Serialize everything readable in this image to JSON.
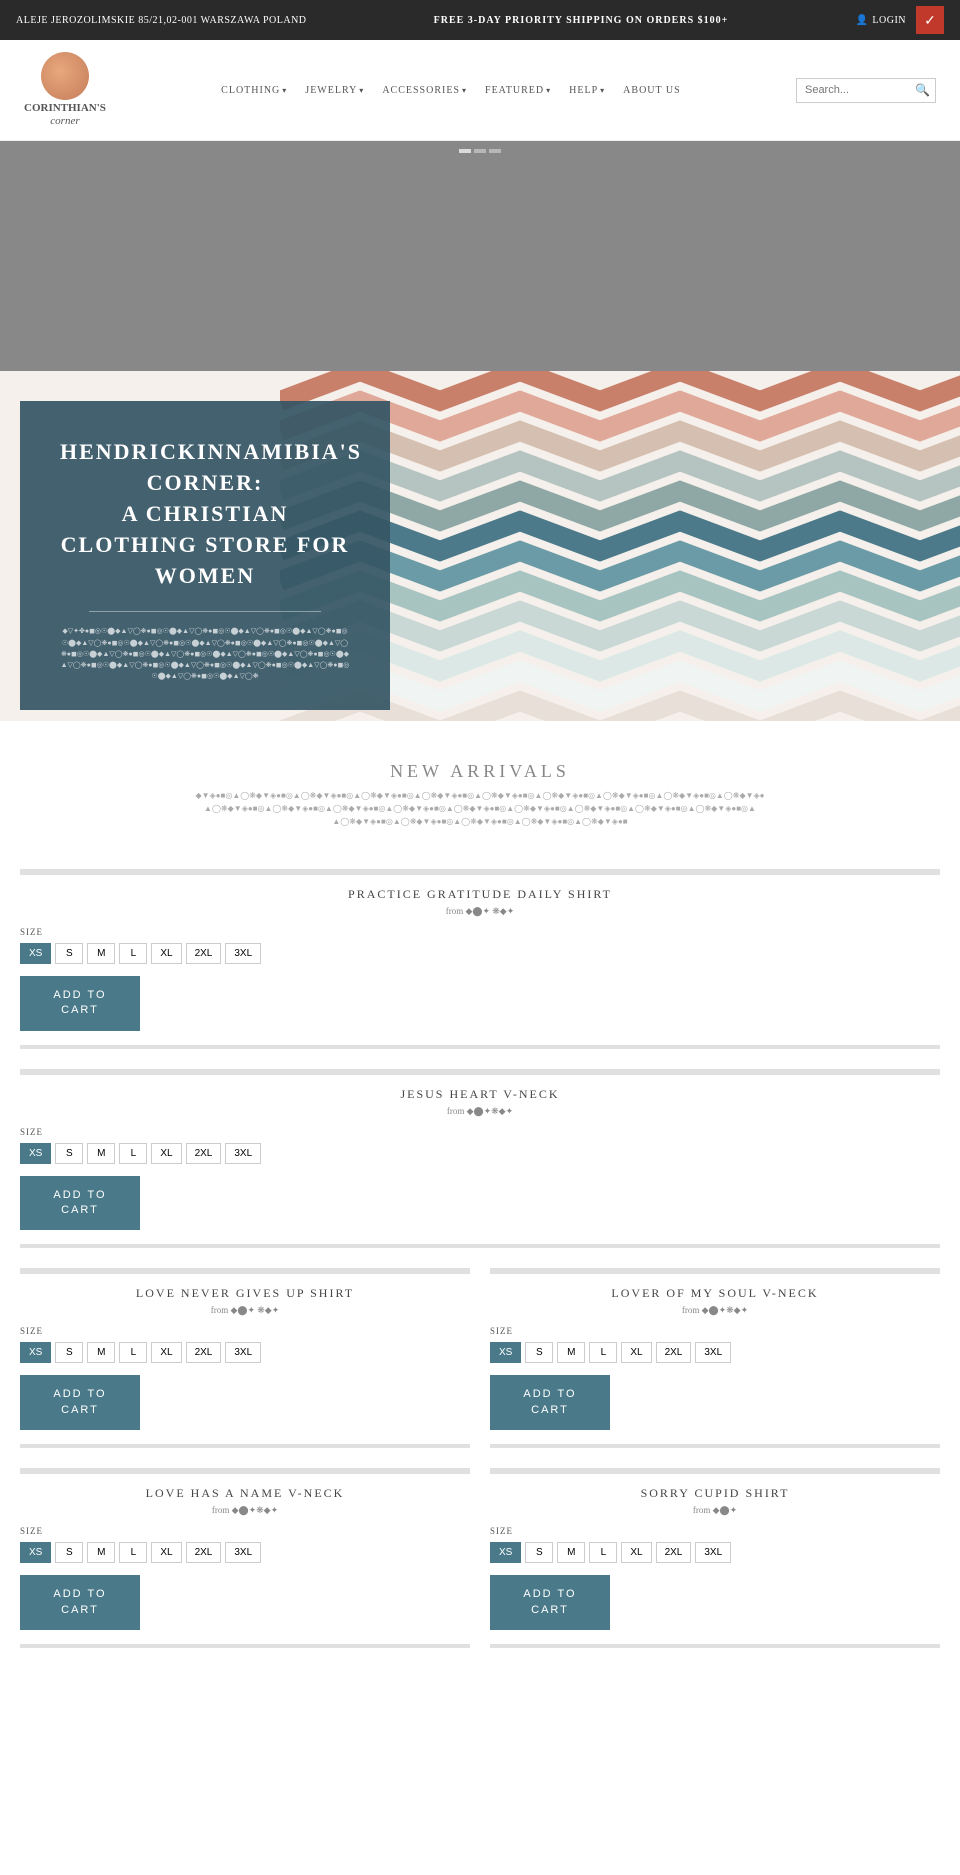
{
  "topbar": {
    "address": "ALEJE JEROZOLIMSKIE 85/21,02-001 WARSZAWA POLAND",
    "shipping": "FREE 3-DAY PRIORITY SHIPPING ON ORDERS $100+",
    "login": "LOGIN",
    "cart_icon": "🛒"
  },
  "header": {
    "logo_name": "CORINTHIAN'S",
    "logo_sub": "corner",
    "nav": [
      {
        "label": "CLOTHING",
        "has_dropdown": true
      },
      {
        "label": "JEWELRY",
        "has_dropdown": true
      },
      {
        "label": "ACCESSORIES",
        "has_dropdown": true
      },
      {
        "label": "FEATURED",
        "has_dropdown": true
      },
      {
        "label": "HELP",
        "has_dropdown": true
      },
      {
        "label": "ABOUT US",
        "has_dropdown": false
      }
    ],
    "search_placeholder": "Search..."
  },
  "hero": {
    "overlay_text": ""
  },
  "promo": {
    "title": "HENDRICKINNAMIBIA'S CORNER:\nA CHRISTIAN CLOTHING STORE FOR WOMEN",
    "symbols": "◆▽✦✤●◼◎☉⬤◆▲▽◯❋●◼◎☉⬤◆▲▽◯❋●◼◎☉⬤◆▲▽◯❋●◼◎☉⬤◆▲▽◯❋●◼◎☉⬤◆▲▽◯❋●◼◎☉⬤◆▲▽◯❋●◼◎☉⬤◆▲▽◯❋●◼◎☉⬤◆▲▽◯❋●◼◎☉⬤◆▲▽◯❋●◼◎☉⬤◆▲▽◯❋●◼◎☉⬤◆▲▽◯❋●◼◎☉⬤◆▲▽◯❋●◼◎☉⬤◆▲▽◯❋●◼◎☉⬤◆▲▽◯❋●◼◎☉⬤◆▲▽◯❋●◼◎☉⬤◆▲▽◯❋●◼◎☉⬤◆▲▽◯❋●◼◎☉⬤◆▲▽◯❋●◼◎☉⬤◆▲▽◯❋●◼◎☉⬤◆▲▽◯❋"
  },
  "new_arrivals": {
    "title": "NEW ARRIVALS",
    "symbols_line1": "◆▼◈●■◎▲◯❋◆▼◈●■◎▲◯❋◆▼◈●■◎▲◯❋◆▼◈●■◎▲◯❋◆▼◈●■◎▲◯❋◆▼◈●■◎▲◯❋◆▼◈●■◎▲◯❋◆▼◈●■◎▲◯❋◆▼◈●■◎▲◯❋◆▼◈●",
    "symbols_line2": "▲◯❋◆▼◈●■◎▲◯❋◆▼◈●■◎▲◯❋◆▼◈●■◎▲◯❋◆▼◈●■◎▲◯❋◆▼◈●■◎▲◯❋◆▼◈●■◎▲◯❋◆▼◈●■◎▲◯❋◆▼◈●■◎▲◯❋◆▼◈●■◎▲",
    "symbols_line3": "▲◯❋◆▼◈●■◎▲◯❋◆▼◈●■◎▲◯❋◆▼◈●■◎▲◯❋◆▼◈●■◎▲◯❋◆▼◈●■"
  },
  "products": [
    {
      "id": "product-1",
      "title": "PRACTICE GRATITUDE DAILY SHIRT",
      "price": "from ◆⬤✦ ❋◆✦",
      "sizes": [
        "XS",
        "S",
        "M",
        "L",
        "XL",
        "2XL",
        "3XL"
      ],
      "active_size": "XS",
      "add_to_cart": "ADD TO\nCART",
      "layout": "single"
    },
    {
      "id": "product-2",
      "title": "JESUS HEART V-NECK",
      "price": "from ◆⬤✦❋◆✦",
      "sizes": [
        "XS",
        "S",
        "M",
        "L",
        "XL",
        "2XL",
        "3XL"
      ],
      "active_size": "XS",
      "add_to_cart": "ADD TO\nCART",
      "layout": "single"
    },
    {
      "id": "product-3",
      "title": "LOVE NEVER GIVES UP SHIRT",
      "price": "from ◆⬤✦ ❋◆✦",
      "sizes": [
        "XS",
        "S",
        "M",
        "L",
        "XL",
        "2XL",
        "3XL"
      ],
      "active_size": "XS",
      "add_to_cart": "ADD TO\nCART",
      "layout": "double-left"
    },
    {
      "id": "product-4",
      "title": "LOVER OF MY SOUL V-NECK",
      "price": "from ◆⬤✦❋◆✦",
      "sizes": [
        "XS",
        "S",
        "M",
        "L",
        "XL",
        "2XL",
        "3XL"
      ],
      "active_size": "XS",
      "add_to_cart": "ADD TO\nCART",
      "layout": "double-right"
    },
    {
      "id": "product-5",
      "title": "LOVE HAS A NAME V-NECK",
      "price": "from ◆⬤✦❋◆✦",
      "sizes": [
        "XS",
        "S",
        "M",
        "L",
        "XL",
        "2XL",
        "3XL"
      ],
      "active_size": "XS",
      "add_to_cart": "ADD TO\nCART",
      "layout": "double-left"
    },
    {
      "id": "product-6",
      "title": "SORRY CUPID SHIRT",
      "price": "from ◆⬤✦",
      "sizes": [
        "XS",
        "S",
        "M",
        "L",
        "XL",
        "2XL",
        "3XL"
      ],
      "active_size": "XS",
      "add_to_cart": "ADD TO\nCART",
      "layout": "double-right"
    }
  ],
  "sizes": [
    "XS",
    "S",
    "M",
    "L",
    "XL",
    "2XL",
    "3XL"
  ],
  "size_label": "SIZE",
  "add_to_cart_label": "ADD TO\nCART"
}
